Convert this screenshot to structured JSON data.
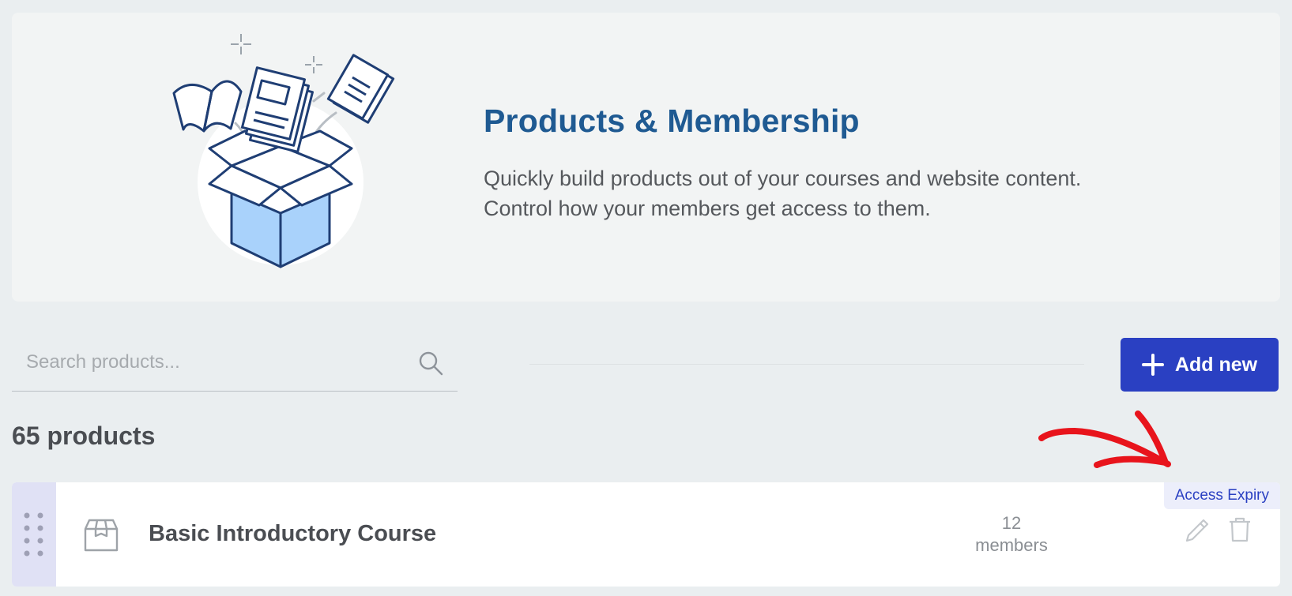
{
  "hero": {
    "title": "Products & Membership",
    "description": "Quickly build products out of your courses and website content. Control how your members get access to them."
  },
  "search": {
    "placeholder": "Search products...",
    "value": ""
  },
  "toolbar": {
    "add_label": "Add new"
  },
  "count_label": "65 products",
  "products": [
    {
      "name": "Basic Introductory Course",
      "members_count": "12",
      "members_label": "members",
      "badge": "Access Expiry"
    }
  ],
  "colors": {
    "accent": "#2a40c2",
    "title": "#1f5a92",
    "annotation": "#e8141c"
  },
  "icons": [
    "box-illustration-icon",
    "search-icon",
    "plus-icon",
    "drag-handle-icon",
    "product-box-icon",
    "pencil-icon",
    "trash-icon",
    "arrow-annotation-icon"
  ]
}
